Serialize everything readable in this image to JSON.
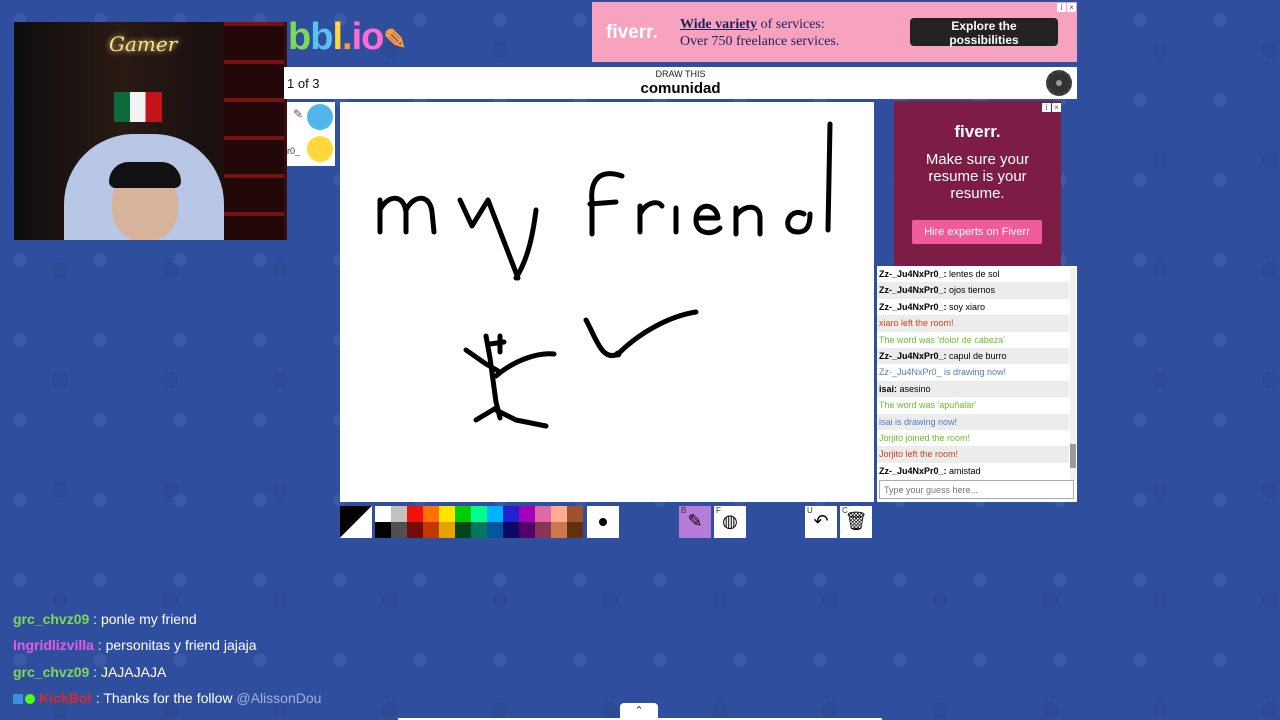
{
  "logo": {
    "text": "bbl.io"
  },
  "top_ad": {
    "brand": "fiverr.",
    "line1_bold": "Wide variety",
    "line1_rest": " of services:",
    "line2": "Over 750 freelance services.",
    "cta": "Explore the possibilities"
  },
  "header": {
    "round": "1 of 3",
    "label": "DRAW THIS",
    "word": "comunidad"
  },
  "players": [
    {
      "name": "",
      "avatar_color": "#4fb5ea",
      "drawing": true
    },
    {
      "name": "r0_",
      "avatar_color": "#ffd93b",
      "drawing": false
    }
  ],
  "canvas": {
    "written_text": "my friend"
  },
  "right_ad": {
    "brand": "fiverr.",
    "message": "Make sure your resume is your resume.",
    "cta": "Hire experts on Fiverr"
  },
  "chat": {
    "messages": [
      {
        "user": "Zz-_Ju4NxPr0_:",
        "text": " lentes de sol",
        "kind": "normal"
      },
      {
        "user": "Zz-_Ju4NxPr0_:",
        "text": " ojos tiernos",
        "kind": "normal"
      },
      {
        "user": "Zz-_Ju4NxPr0_:",
        "text": " soy xiaro",
        "kind": "normal"
      },
      {
        "user": "",
        "text": "xiaro left the room!",
        "kind": "red"
      },
      {
        "user": "",
        "text": "The word was 'dolor de cabeza'",
        "kind": "green"
      },
      {
        "user": "Zz-_Ju4NxPr0_:",
        "text": " capul de burro",
        "kind": "normal"
      },
      {
        "user": "",
        "text": "Zz-_Ju4NxPr0_ is drawing now!",
        "kind": "blue"
      },
      {
        "user": "isai:",
        "text": " asesino",
        "kind": "normal"
      },
      {
        "user": "",
        "text": "The word was 'apuñalar'",
        "kind": "green"
      },
      {
        "user": "",
        "text": "isai is drawing now!",
        "kind": "blue"
      },
      {
        "user": "",
        "text": "Jorjito joined the room!",
        "kind": "green"
      },
      {
        "user": "",
        "text": "Jorjito left the room!",
        "kind": "red"
      },
      {
        "user": "Zz-_Ju4NxPr0_:",
        "text": " amistad",
        "kind": "normal"
      }
    ],
    "input_placeholder": "Type your guess here..."
  },
  "toolbar": {
    "palette_top": [
      "#ffffff",
      "#c1c1c1",
      "#ef130b",
      "#ff7100",
      "#ffe400",
      "#00cc00",
      "#00ff91",
      "#00b2ff",
      "#231fd3",
      "#a300ba",
      "#df69a7",
      "#ffac8e",
      "#a0522d"
    ],
    "palette_bottom": [
      "#000000",
      "#505050",
      "#740b07",
      "#c23800",
      "#e8a200",
      "#004619",
      "#00785d",
      "#00569e",
      "#0e0865",
      "#550069",
      "#873554",
      "#cc774d",
      "#63300d"
    ],
    "brush_key": "B",
    "fill_key": "F",
    "undo_key": "U",
    "clear_key": "C",
    "icons": {
      "brush": "pencil-icon",
      "fill": "bucket-icon",
      "undo": "undo-icon",
      "clear": "trash-icon"
    }
  },
  "stream_chat": [
    {
      "user": "grc_chvz09",
      "user_color": "#7ed957",
      "sep": " : ",
      "text": "ponle my friend",
      "mention": ""
    },
    {
      "user": "Ingridlizvilla",
      "user_color": "#e05ce8",
      "sep": " : ",
      "text": "personitas y friend jajaja",
      "mention": ""
    },
    {
      "user": "grc_chvz09",
      "user_color": "#7ed957",
      "sep": " : ",
      "text": "JAJAJAJA",
      "mention": ""
    },
    {
      "user": "KickBot",
      "user_color": "#d42b2b",
      "sep": " : ",
      "text": "Thanks for the follow ",
      "mention": "@AlissonDou"
    }
  ]
}
